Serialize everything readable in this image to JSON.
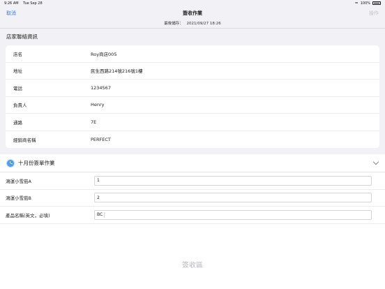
{
  "status": {
    "time": "9:26 AM",
    "date": "Tue Sep 28",
    "battery": "100%"
  },
  "nav": {
    "cancel": "取消",
    "title": "簽收作業",
    "action": "操作"
  },
  "save": {
    "label": "最後儲存：",
    "timestamp": "2021/09/27 18:26"
  },
  "store_section": {
    "title": "店家聯絡資訊",
    "rows": [
      {
        "label": "店名",
        "value": "Roy商店005"
      },
      {
        "label": "地址",
        "value": "民生西路214號216號1樓"
      },
      {
        "label": "電話",
        "value": "1234567"
      },
      {
        "label": "負責人",
        "value": "Henry"
      },
      {
        "label": "通路",
        "value": "7E"
      },
      {
        "label": "經銷商名稱",
        "value": "PERFECT"
      }
    ]
  },
  "form_section": {
    "title": "十月份簽單作業",
    "fields": [
      {
        "label": "鴻運小雪茄A",
        "value": "1"
      },
      {
        "label": "鴻運小雪茄B",
        "value": "2"
      },
      {
        "label": "產品名稱(英文，必填)",
        "value": "BC"
      }
    ],
    "sign_area": "簽收區"
  },
  "icons": {
    "form_icon": "clock-icon",
    "collapse": "chevron-down-icon"
  }
}
